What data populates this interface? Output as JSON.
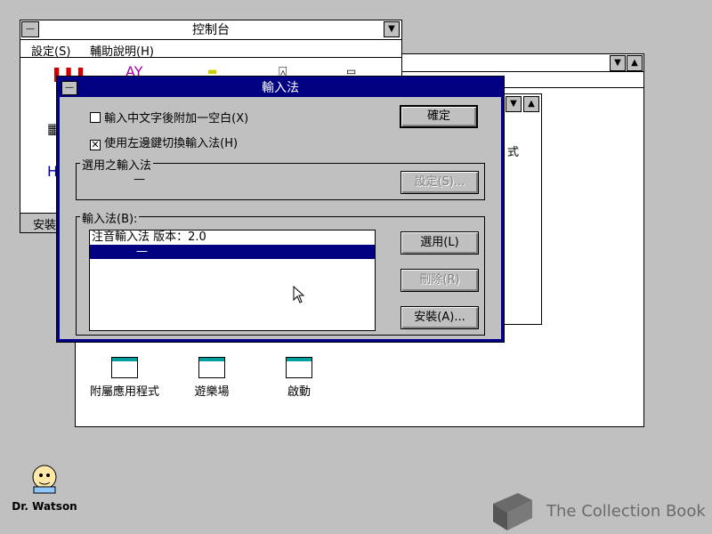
{
  "control_panel": {
    "title": "控制台",
    "menu": [
      "設定(S)",
      "輔助說明(H)"
    ],
    "status_text": "安裝"
  },
  "program_manager": {
    "groups": [
      "附屬應用程式",
      "遊樂場",
      "啟動"
    ],
    "partial_text": "式"
  },
  "dialog": {
    "title": "輸入法",
    "checkbox1": {
      "label": "輸入中文字後附加一空白(X)",
      "checked": false
    },
    "checkbox2": {
      "label": "使用左邊鍵切換輸入法(H)",
      "checked": true
    },
    "ok_label": "確定",
    "selected_group_label": "選用之輸入法",
    "selected_value": "—",
    "settings_label": "設定(S)...",
    "ime_group_label": "輸入法(B):",
    "ime_list": [
      "注音輸入法 版本：2.0",
      "—"
    ],
    "use_label": "選用(L)",
    "delete_label": "刪除(R)",
    "install_label": "安裝(A)..."
  },
  "desktop": {
    "dr_watson_label": "Dr. Watson",
    "watermark": "The Collection Book"
  },
  "colors": {
    "title_active": "#000080",
    "desktop": "#c0c0c0"
  }
}
